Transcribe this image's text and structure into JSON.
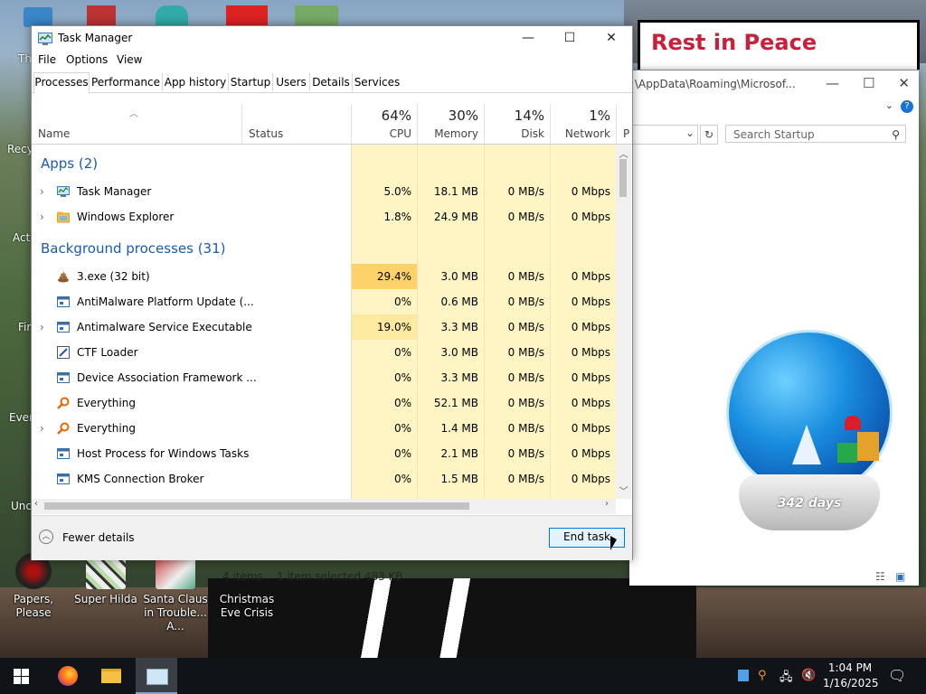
{
  "desktop": {
    "sign_text": "Rest in Peace",
    "icons": [
      {
        "label": "Papers, Please"
      },
      {
        "label": "Super Hilda"
      },
      {
        "label": "Santa Claus in Trouble... A..."
      },
      {
        "label": "Christmas Eve Crisis"
      }
    ],
    "left_labels": [
      "Th",
      "Recy",
      "Act",
      "Fir",
      "Ever",
      "Unc"
    ],
    "snowglobe_text": "342 days"
  },
  "explorer": {
    "path": "\\AppData\\Roaming\\Microsof...",
    "search_placeholder": "Search Startup",
    "status_items": "4 items",
    "status_selected": "1 item selected  483 KB"
  },
  "task_manager": {
    "title": "Task Manager",
    "menu": [
      "File",
      "Options",
      "View"
    ],
    "tabs": [
      "Processes",
      "Performance",
      "App history",
      "Startup",
      "Users",
      "Details",
      "Services"
    ],
    "active_tab": "Processes",
    "columns": {
      "name": "Name",
      "status": "Status",
      "cpu": {
        "pct": "64%",
        "label": "CPU"
      },
      "memory": {
        "pct": "30%",
        "label": "Memory"
      },
      "disk": {
        "pct": "14%",
        "label": "Disk"
      },
      "network": {
        "pct": "1%",
        "label": "Network"
      },
      "power_abbrev": "P"
    },
    "groups": {
      "apps": "Apps (2)",
      "background": "Background processes (31)"
    },
    "apps": [
      {
        "name": "Task Manager",
        "cpu": "5.0%",
        "memory": "18.1 MB",
        "disk": "0 MB/s",
        "network": "0 Mbps",
        "expandable": true
      },
      {
        "name": "Windows Explorer",
        "cpu": "1.8%",
        "memory": "24.9 MB",
        "disk": "0 MB/s",
        "network": "0 Mbps",
        "expandable": true
      }
    ],
    "background": [
      {
        "name": "3.exe (32 bit)",
        "cpu": "29.4%",
        "memory": "3.0 MB",
        "disk": "0 MB/s",
        "network": "0 Mbps",
        "expandable": false,
        "cpu_high": true
      },
      {
        "name": "AntiMalware Platform Update (...",
        "cpu": "0%",
        "memory": "0.6 MB",
        "disk": "0 MB/s",
        "network": "0 Mbps",
        "expandable": false
      },
      {
        "name": "Antimalware Service Executable",
        "cpu": "19.0%",
        "memory": "3.3 MB",
        "disk": "0 MB/s",
        "network": "0 Mbps",
        "expandable": true,
        "cpu_high": true
      },
      {
        "name": "CTF Loader",
        "cpu": "0%",
        "memory": "3.0 MB",
        "disk": "0 MB/s",
        "network": "0 Mbps",
        "expandable": false
      },
      {
        "name": "Device Association Framework ...",
        "cpu": "0%",
        "memory": "3.3 MB",
        "disk": "0 MB/s",
        "network": "0 Mbps",
        "expandable": false
      },
      {
        "name": "Everything",
        "cpu": "0%",
        "memory": "52.1 MB",
        "disk": "0 MB/s",
        "network": "0 Mbps",
        "expandable": false
      },
      {
        "name": "Everything",
        "cpu": "0%",
        "memory": "1.4 MB",
        "disk": "0 MB/s",
        "network": "0 Mbps",
        "expandable": true
      },
      {
        "name": "Host Process for Windows Tasks",
        "cpu": "0%",
        "memory": "2.1 MB",
        "disk": "0 MB/s",
        "network": "0 Mbps",
        "expandable": false
      },
      {
        "name": "KMS Connection Broker",
        "cpu": "0%",
        "memory": "1.5 MB",
        "disk": "0 MB/s",
        "network": "0 Mbps",
        "expandable": false
      }
    ],
    "footer": {
      "fewer_details": "Fewer details",
      "end_task": "End task"
    }
  },
  "taskbar": {
    "time": "1:04 PM",
    "date": "1/16/2025"
  },
  "colors": {
    "usage_light": "#fff4c4",
    "usage_med": "#fde9a0",
    "usage_high": "#fdd26b",
    "group_blue": "#1e5aa8",
    "accent": "#0078d7"
  }
}
